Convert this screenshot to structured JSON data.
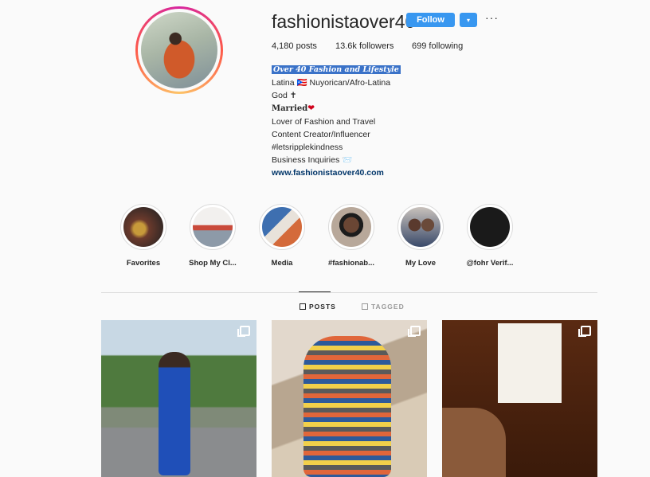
{
  "profile": {
    "username": "fashionistaover40",
    "follow_label": "Follow",
    "dropdown_icon": "▾",
    "more_icon": "···",
    "stats": {
      "posts": "4,180 posts",
      "followers": "13.6k followers",
      "following": "699 following"
    },
    "bio": {
      "headline": "Over 40 Fashion and Lifestyle",
      "line1": "Latina 🇵🇷 Nuyorican/Afro-Latina",
      "line2": "God ✝",
      "line3": "Married",
      "line3_icon": "❤",
      "line4": "Lover of Fashion and Travel",
      "line5": "Content Creator/Influencer",
      "line6": "#letsripplekindness",
      "line7": "Business Inquiries 📨",
      "website": "www.fashionistaover40.com"
    }
  },
  "highlights": [
    {
      "label": "Favorites"
    },
    {
      "label": "Shop My Cl..."
    },
    {
      "label": "Media"
    },
    {
      "label": "#fashionab..."
    },
    {
      "label": "My Love"
    },
    {
      "label": "@fohr Verif..."
    }
  ],
  "tabs": {
    "posts": "POSTS",
    "tagged": "TAGGED"
  },
  "colors": {
    "accent": "#3897f0",
    "link": "#003569",
    "divider": "#dbdbdb"
  }
}
